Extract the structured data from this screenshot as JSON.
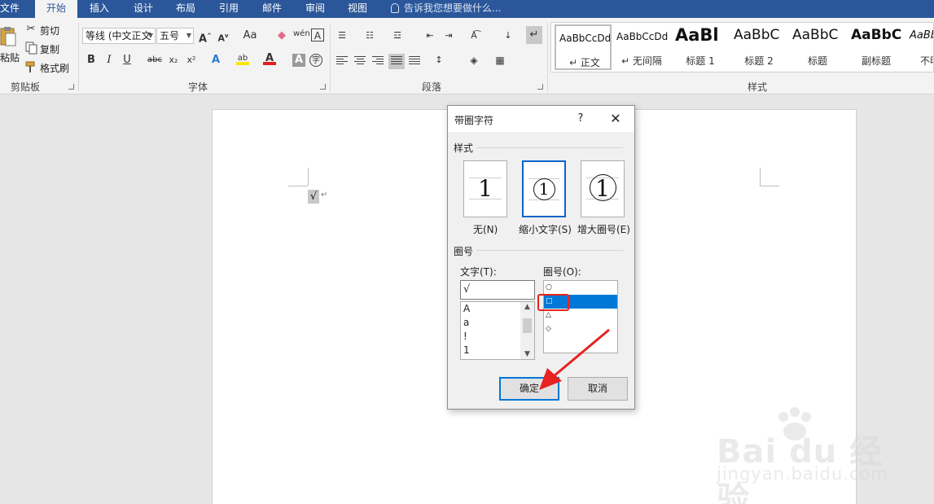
{
  "tabs": [
    "文件",
    "开始",
    "插入",
    "设计",
    "布局",
    "引用",
    "邮件",
    "审阅",
    "视图"
  ],
  "active_tab": "开始",
  "tell_me": "告诉我您想要做什么...",
  "ribbon": {
    "clipboard": {
      "paste": "粘贴",
      "cut": "剪切",
      "copy": "复制",
      "format_painter": "格式刷",
      "label": "剪贴板"
    },
    "font": {
      "font_name": "等线 (中文正文",
      "font_size": "五号",
      "label": "字体"
    },
    "paragraph": {
      "label": "段落"
    },
    "styles": {
      "label": "样式",
      "items": [
        {
          "sample": "AaBbCcDd",
          "name": "↵ 正文"
        },
        {
          "sample": "AaBbCcDd",
          "name": "↵ 无间隔"
        },
        {
          "sample": "AaBl",
          "name": "标题 1"
        },
        {
          "sample": "AaBbC",
          "name": "标题 2"
        },
        {
          "sample": "AaBbC",
          "name": "标题"
        },
        {
          "sample": "AaBbC",
          "name": "副标题"
        },
        {
          "sample": "AaBbC",
          "name": "不明显"
        }
      ]
    }
  },
  "document": {
    "content": "√",
    "paragraph_mark": "↵"
  },
  "dialog": {
    "title": "带圈字符",
    "help": "?",
    "close": "✕",
    "style_section": "样式",
    "styles": [
      {
        "label": "无(N)",
        "glyph": "1"
      },
      {
        "label": "缩小文字(S)",
        "glyph": "1"
      },
      {
        "label": "增大圈号(E)",
        "glyph": "1"
      }
    ],
    "selected_style": 1,
    "enclosure_section": "圈号",
    "text_label": "文字(T):",
    "text_value": "√",
    "text_list": [
      "A",
      "a",
      "!",
      "1"
    ],
    "enclosure_label": "圈号(O):",
    "enclosure_list": [
      "○",
      "□",
      "△",
      "◇"
    ],
    "selected_enclosure": 1,
    "ok": "确定",
    "cancel": "取消"
  },
  "watermark": {
    "brand": "Bai du 经验",
    "url": "jingyan.baidu.com"
  },
  "colors": {
    "accent": "#2b579a",
    "selection": "#0078d7",
    "annotation": "#e8221f"
  }
}
